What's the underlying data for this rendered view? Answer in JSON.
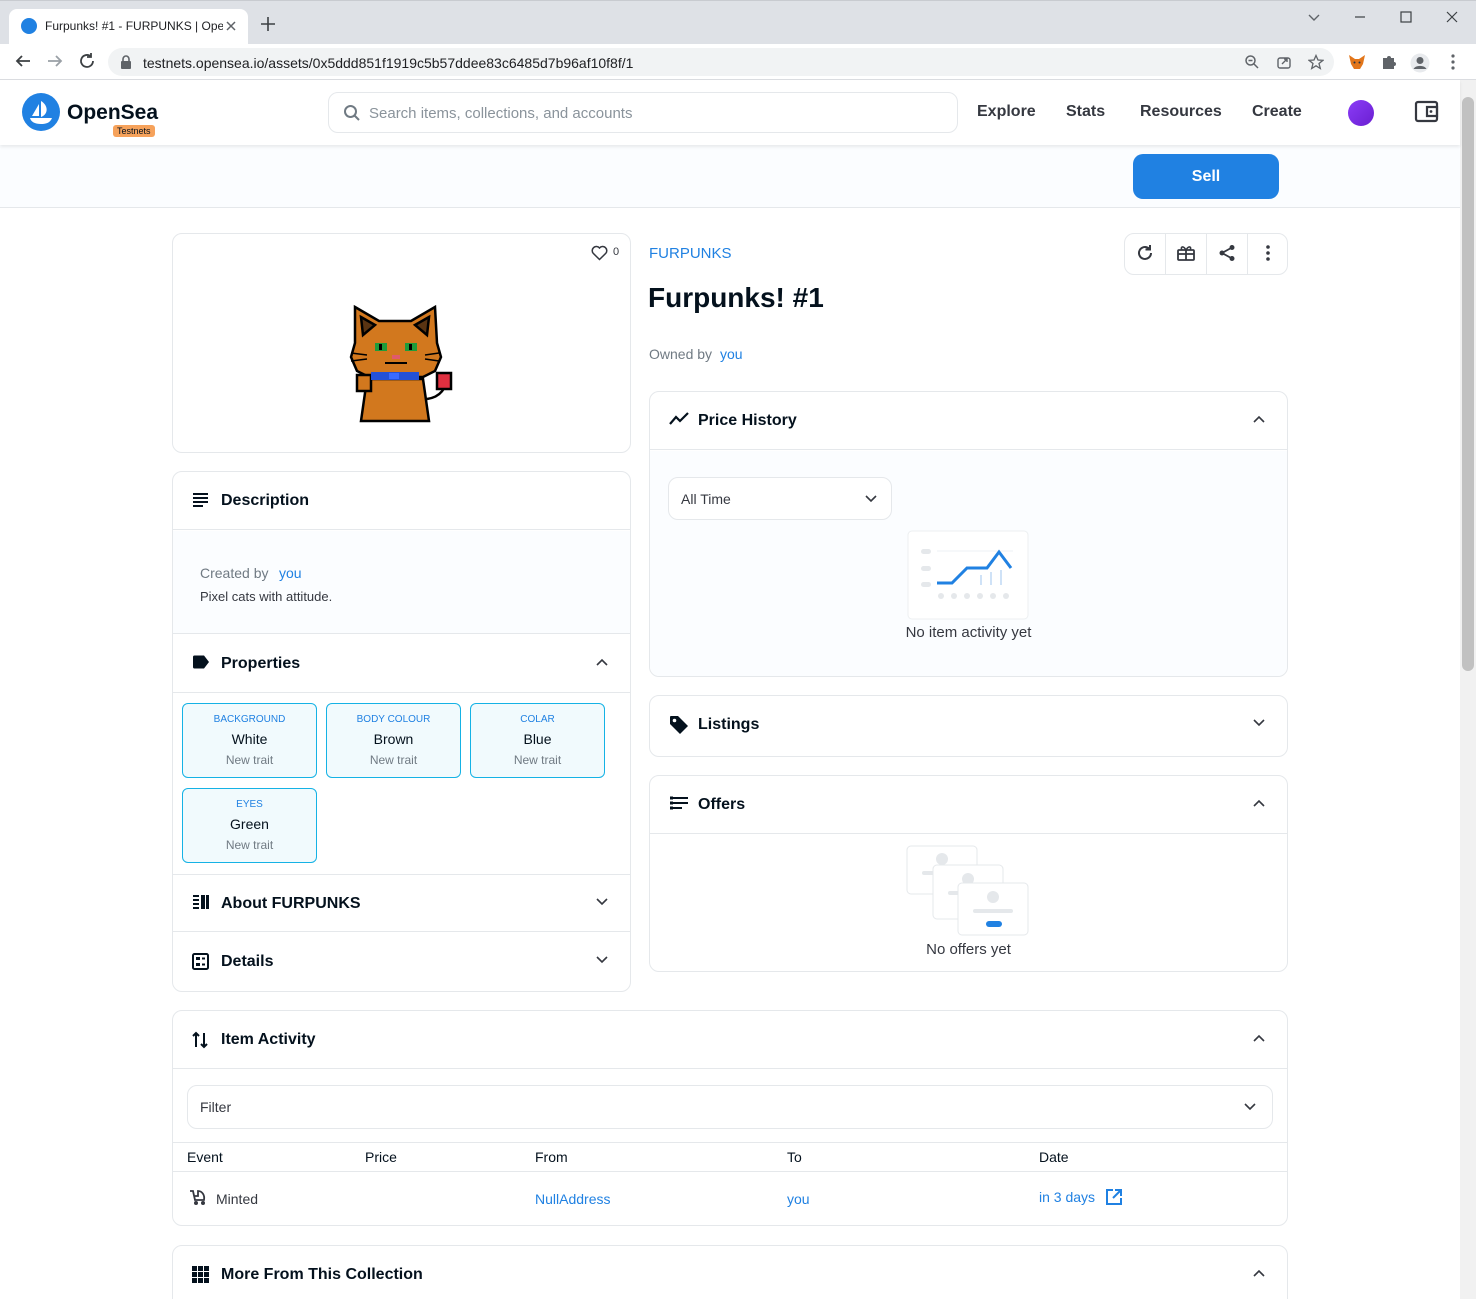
{
  "browser": {
    "tab_title": "Furpunks! #1 - FURPUNKS | OpenSea",
    "url": "testnets.opensea.io/assets/0x5ddd851f1919c5b57ddee83c6485d7b96af10f8f/1"
  },
  "header": {
    "brand": "OpenSea",
    "badge": "Testnets",
    "search_placeholder": "Search items, collections, and accounts",
    "nav": [
      "Explore",
      "Stats",
      "Resources",
      "Create"
    ]
  },
  "sell_label": "Sell",
  "media": {
    "favorites": "0"
  },
  "item": {
    "collection": "FURPUNKS",
    "name": "Furpunks! #1",
    "owned_by_label": "Owned by",
    "owner": "you"
  },
  "description": {
    "title": "Description",
    "created_by_label": "Created by",
    "creator": "you",
    "text": "Pixel cats with attitude."
  },
  "properties": {
    "title": "Properties",
    "traits": [
      {
        "type": "BACKGROUND",
        "value": "White",
        "rarity": "New trait"
      },
      {
        "type": "BODY COLOUR",
        "value": "Brown",
        "rarity": "New trait"
      },
      {
        "type": "COLAR",
        "value": "Blue",
        "rarity": "New trait"
      },
      {
        "type": "EYES",
        "value": "Green",
        "rarity": "New trait"
      }
    ]
  },
  "about": {
    "title": "About FURPUNKS"
  },
  "details": {
    "title": "Details"
  },
  "price_history": {
    "title": "Price History",
    "range": "All Time",
    "empty": "No item activity yet"
  },
  "listings": {
    "title": "Listings"
  },
  "offers": {
    "title": "Offers",
    "empty": "No offers yet"
  },
  "activity": {
    "title": "Item Activity",
    "filter": "Filter",
    "columns": [
      "Event",
      "Price",
      "From",
      "To",
      "Date"
    ],
    "rows": [
      {
        "event": "Minted",
        "price": "",
        "from": "NullAddress",
        "to": "you",
        "date": "in 3 days"
      }
    ]
  },
  "more": {
    "title": "More From This Collection"
  },
  "colors": {
    "accent": "#2081e2",
    "trait_border": "#15b2e5",
    "badge": "#f6a25b"
  }
}
